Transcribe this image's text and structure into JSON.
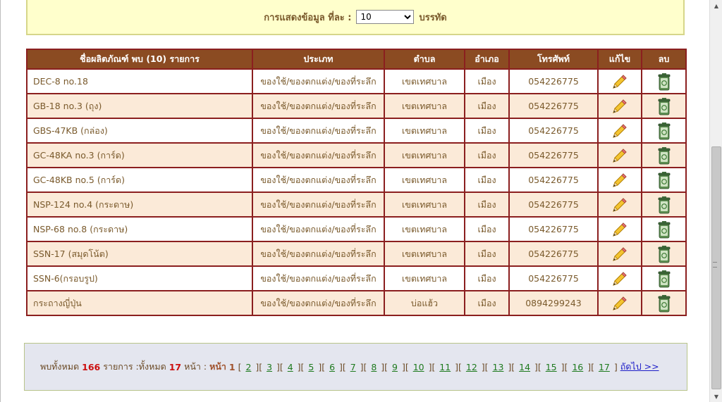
{
  "perpage": {
    "label": "การแสดงข้อมูล ที่ละ :",
    "selected": "10",
    "suffix": "บรรทัด"
  },
  "table": {
    "headers": {
      "name": "ชื่อผลิตภัณฑ์   พบ (10) รายการ",
      "type": "ประเภท",
      "subdistrict": "ตำบล",
      "district": "อำเภอ",
      "phone": "โทรศัพท์",
      "edit": "แก้ไข",
      "delete": "ลบ"
    },
    "rows": [
      {
        "name": "DEC-8 no.18",
        "type": "ของใช้/ของตกแต่ง/ของที่ระลึก",
        "subdistrict": "เขตเทศบาล",
        "district": "เมือง",
        "phone": "054226775"
      },
      {
        "name": "GB-18 no.3 (ถุง)",
        "type": "ของใช้/ของตกแต่ง/ของที่ระลึก",
        "subdistrict": "เขตเทศบาล",
        "district": "เมือง",
        "phone": "054226775"
      },
      {
        "name": "GBS-47KB (กล่อง)",
        "type": "ของใช้/ของตกแต่ง/ของที่ระลึก",
        "subdistrict": "เขตเทศบาล",
        "district": "เมือง",
        "phone": "054226775"
      },
      {
        "name": "GC-48KA no.3 (การ์ด)",
        "type": "ของใช้/ของตกแต่ง/ของที่ระลึก",
        "subdistrict": "เขตเทศบาล",
        "district": "เมือง",
        "phone": "054226775"
      },
      {
        "name": "GC-48KB no.5 (การ์ด)",
        "type": "ของใช้/ของตกแต่ง/ของที่ระลึก",
        "subdistrict": "เขตเทศบาล",
        "district": "เมือง",
        "phone": "054226775"
      },
      {
        "name": "NSP-124 no.4 (กระดาษ)",
        "type": "ของใช้/ของตกแต่ง/ของที่ระลึก",
        "subdistrict": "เขตเทศบาล",
        "district": "เมือง",
        "phone": "054226775"
      },
      {
        "name": "NSP-68 no.8 (กระดาษ)",
        "type": "ของใช้/ของตกแต่ง/ของที่ระลึก",
        "subdistrict": "เขตเทศบาล",
        "district": "เมือง",
        "phone": "054226775"
      },
      {
        "name": "SSN-17 (สมุดโน้ต)",
        "type": "ของใช้/ของตกแต่ง/ของที่ระลึก",
        "subdistrict": "เขตเทศบาล",
        "district": "เมือง",
        "phone": "054226775"
      },
      {
        "name": "SSN-6(กรอบรูป)",
        "type": "ของใช้/ของตกแต่ง/ของที่ระลึก",
        "subdistrict": "เขตเทศบาล",
        "district": "เมือง",
        "phone": "054226775"
      },
      {
        "name": "กระถางญี่ปุ่น",
        "type": "ของใช้/ของตกแต่ง/ของที่ระลึก",
        "subdistrict": "บ่อแฮ้ว",
        "district": "เมือง",
        "phone": "0894299243"
      }
    ],
    "edit_icon": "pencil-icon",
    "delete_icon": "trash-bin-icon"
  },
  "pager": {
    "found_prefix": "พบทั้งหมด",
    "total_items": "166",
    "items_mid": "รายการ :ทั้งหมด",
    "total_pages": "17",
    "pages_label": "หน้า :",
    "page_prefix": "หน้า",
    "current_page": "1",
    "pages": [
      "2",
      "3",
      "4",
      "5",
      "6",
      "7",
      "8",
      "9",
      "10",
      "11",
      "12",
      "13",
      "14",
      "15",
      "16",
      "17"
    ],
    "next_label": "ถัดไป >>"
  },
  "colors": {
    "header_bg": "#8b4b22",
    "border": "#8b1f1f",
    "even_row": "#fbead8",
    "text": "#7a5a2c",
    "count_red": "#cc1111",
    "page_link": "#1e7a1e",
    "next_link": "#1c1cc8"
  }
}
